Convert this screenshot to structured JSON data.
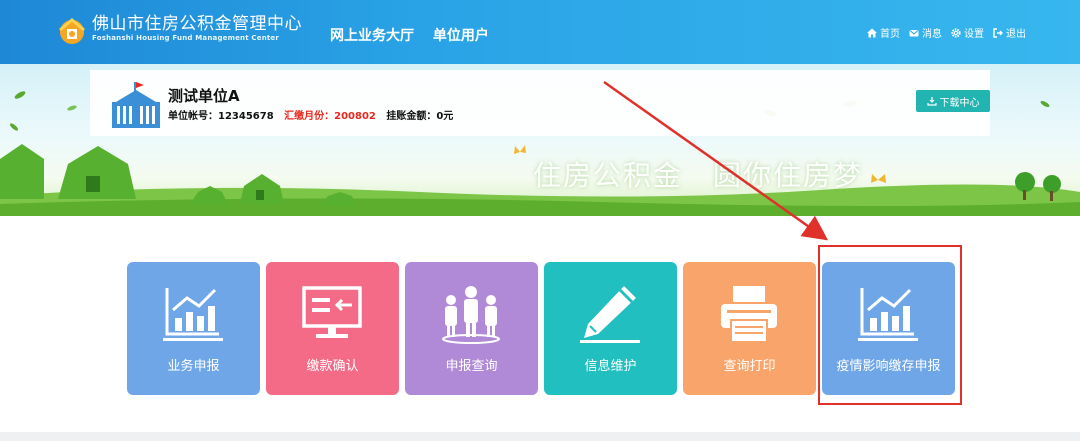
{
  "header": {
    "brand_cn": "佛山市住房公积金管理中心",
    "brand_en": "Foshanshi Housing Fund Management Center",
    "nav": [
      "网上业务大厅",
      "单位用户"
    ],
    "links": [
      {
        "icon": "home-icon",
        "label": "首页"
      },
      {
        "icon": "message-icon",
        "label": "消息"
      },
      {
        "icon": "gear-icon",
        "label": "设置"
      },
      {
        "icon": "logout-icon",
        "label": "退出"
      }
    ]
  },
  "unit": {
    "name": "测试单位A",
    "account_label": "单位帐号：",
    "account_value": "12345678",
    "month_label": "汇缴月份：",
    "month_value": "200802",
    "balance_label": "挂账金额：",
    "balance_value": "0元",
    "download_label": "下载中心"
  },
  "banner": {
    "slogan": "住房公积金　圆你住房梦"
  },
  "tiles": [
    {
      "label": "业务申报",
      "icon": "chart-icon",
      "color": "#6fa6e8"
    },
    {
      "label": "缴款确认",
      "icon": "monitor-icon",
      "color": "#f36b86"
    },
    {
      "label": "申报查询",
      "icon": "people-icon",
      "color": "#b08ad6"
    },
    {
      "label": "信息维护",
      "icon": "pen-icon",
      "color": "#21bfc0"
    },
    {
      "label": "查询打印",
      "icon": "printer-icon",
      "color": "#f9a46a"
    },
    {
      "label": "疫情影响缴存申报",
      "icon": "chart-icon",
      "color": "#6fa6e8"
    }
  ],
  "colors": {
    "annotation": "#e0302a",
    "header": "#2aa3e6",
    "accent_red": "#e8281e"
  }
}
